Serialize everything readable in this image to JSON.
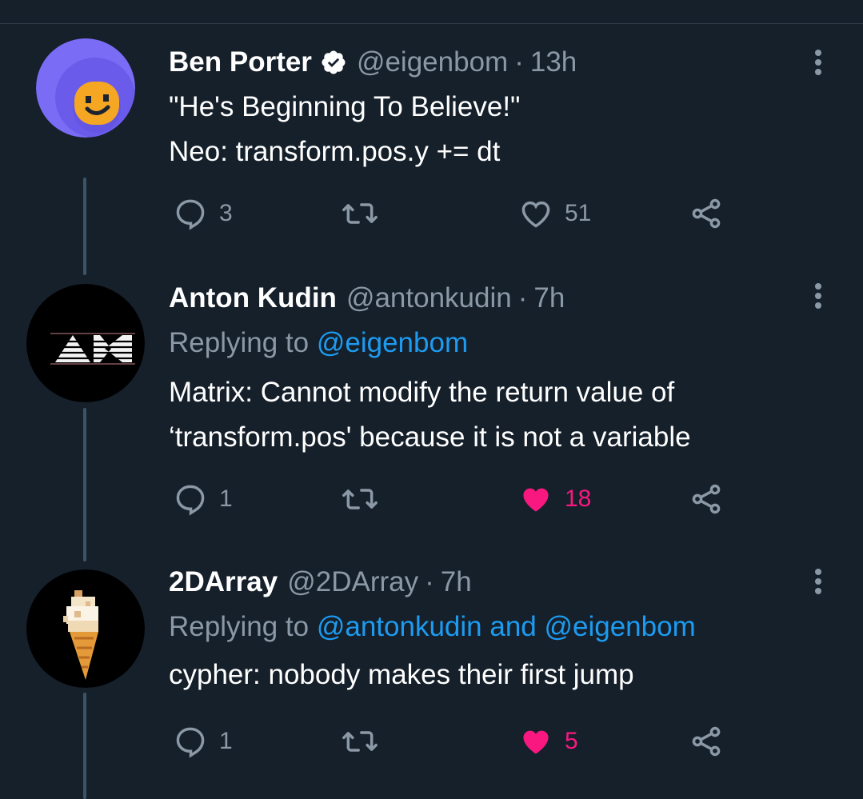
{
  "tweets": [
    {
      "name": "Ben Porter",
      "verified": true,
      "handle": "@eigenbom",
      "separator": "·",
      "time": "13h",
      "text_lines": [
        "\"He's Beginning To Believe!\"",
        "Neo: transform.pos.y += dt"
      ],
      "replies": "3",
      "retweets": "",
      "likes": "51",
      "liked": false,
      "avatar_color": "#7b6cf5"
    },
    {
      "name": "Anton Kudin",
      "verified": false,
      "handle": "@antonkudin",
      "separator": "·",
      "time": "7h",
      "replying_prefix": "Replying to",
      "replying_to": "@eigenbom",
      "text_lines": [
        "Matrix: Cannot modify the return value of",
        "‘transform.pos' because it is not a variable"
      ],
      "replies": "1",
      "retweets": "",
      "likes": "18",
      "liked": true,
      "avatar_color": "#000000"
    },
    {
      "name": "2DArray",
      "verified": false,
      "handle": "@2DArray",
      "separator": "·",
      "time": "7h",
      "replying_prefix": "Replying to",
      "replying_to": "@antonkudin and @eigenbom",
      "text_lines": [
        "cypher: nobody makes their first jump"
      ],
      "replies": "1",
      "retweets": "",
      "likes": "5",
      "liked": true,
      "avatar_color": "#000000"
    }
  ],
  "colors": {
    "background": "#15202b",
    "muted": "#8b98a5",
    "link": "#1d9bf0",
    "like": "#f91880",
    "verified": "#ffffff"
  }
}
